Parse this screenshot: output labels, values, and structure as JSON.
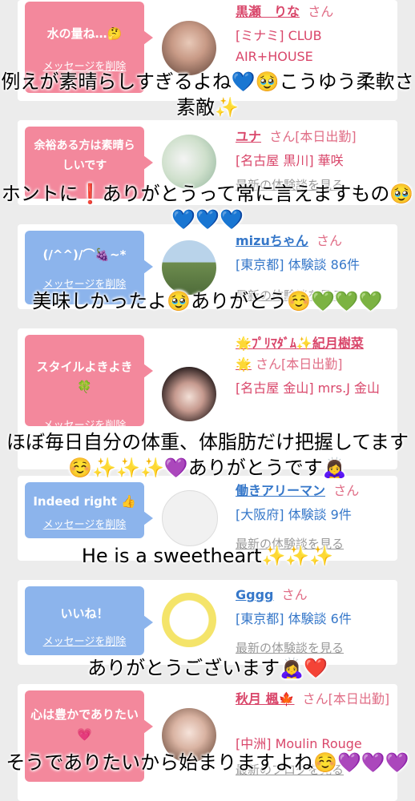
{
  "cards": [
    {
      "bubble": "水の量ね…🤔",
      "delete": "メッセージを削除",
      "name": "黒瀬　りな",
      "suffix": "さん",
      "location": "[ミナミ] CLUB",
      "location2": "AIR+HOUSE",
      "more": "最新の体験談を見る"
    },
    {
      "bubble": "余裕ある方は素晴らしいです",
      "delete": "メッセージを削除",
      "name": "ユナ",
      "suffix": "さん[本日出勤]",
      "location": "[名古屋 黒川] 華咲",
      "more": "最新の体験談を見る"
    },
    {
      "bubble": "(/^^)/⌒🍇~*",
      "delete": "メッセージを削除",
      "name": "mizuちゃん",
      "suffix": "さん",
      "location": "[東京都] 体験談 86件",
      "more": "最新の体験談を見る"
    },
    {
      "bubble": "スタイルよきよき🍀",
      "delete": "メッセージを削除",
      "name": "🌟ﾌﾟﾘﾏﾀﾞﾑ✨紀月樹菜🌟",
      "suffix": "さん[本日出勤]",
      "location": "[名古屋 金山] mrs.J 金山",
      "more": "最新の体験談を見る"
    },
    {
      "bubble": "Indeed right 👍",
      "delete": "メッセージを削除",
      "name": "働きアリーマン",
      "suffix": "さん",
      "location": "[大阪府] 体験談 9件",
      "more": "最新の体験談を見る"
    },
    {
      "bubble": "いいね！",
      "delete": "メッセージを削除",
      "name": "Gggg",
      "suffix": "さん",
      "location": "[東京都] 体験談 6件",
      "more": "最新の体験談を見る"
    },
    {
      "bubble": "心は豊かでありたい💗",
      "delete": "メッセージを削除",
      "name": "秋月 楓🍁",
      "suffix": "さん[本日出勤]",
      "location": "[中洲] Moulin Rouge",
      "more": "最新のブログを見る"
    }
  ],
  "overlays": [
    "例えが素晴らしすぎるよね💙🥹こうゆう柔軟さ素敵✨",
    "ホントに❗️ありがとうって常に言えますもの🥹💙💙💙",
    "美味しかったよ🥹ありがとう☺️💚💚💚",
    "ほぼ毎日自分の体重、体脂肪だけ把握してます☺️✨✨✨💜ありがとうです🙇‍♀️",
    "He is a sweetheart✨✨✨",
    "ありがとうございます🙇‍♀️❤️",
    "そうでありたいから始まりますよね☺️💜💜💜"
  ],
  "colors": {
    "pink_bubble": "#f3889c",
    "blue_bubble": "#8cb4ec",
    "pink_name": "#d9466a",
    "blue_name": "#3577c9"
  }
}
